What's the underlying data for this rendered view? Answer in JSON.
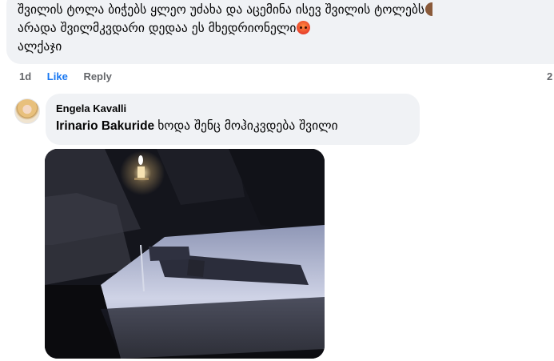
{
  "top_comment": {
    "line1": "შვილის ტოლა ბიჭებს ყლეო უძახა და აცემინა ისევ შვილის ტოლებს",
    "line2": "არადა შვილმკვდარი დედაა ეს მხედრიონელი",
    "line3": "ალქაჯი",
    "emoji_line1": "emoji-partial-icon",
    "emoji_line2": "angry-face-icon"
  },
  "actions": {
    "time": "1d",
    "like": "Like",
    "reply": "Reply",
    "right_count": "2"
  },
  "reply_comment": {
    "author": "Engela Kavalli",
    "mention": "Irinario Bakuride",
    "text": "ხოდა შენც მოჰიკვდება შვილი",
    "avatar": "avatar-photo",
    "attachment": "dark-candle-cross-image"
  },
  "colors": {
    "bubble": "#f0f2f5",
    "link_blue": "#1877f2",
    "meta_gray": "#65676b",
    "text": "#050505"
  }
}
